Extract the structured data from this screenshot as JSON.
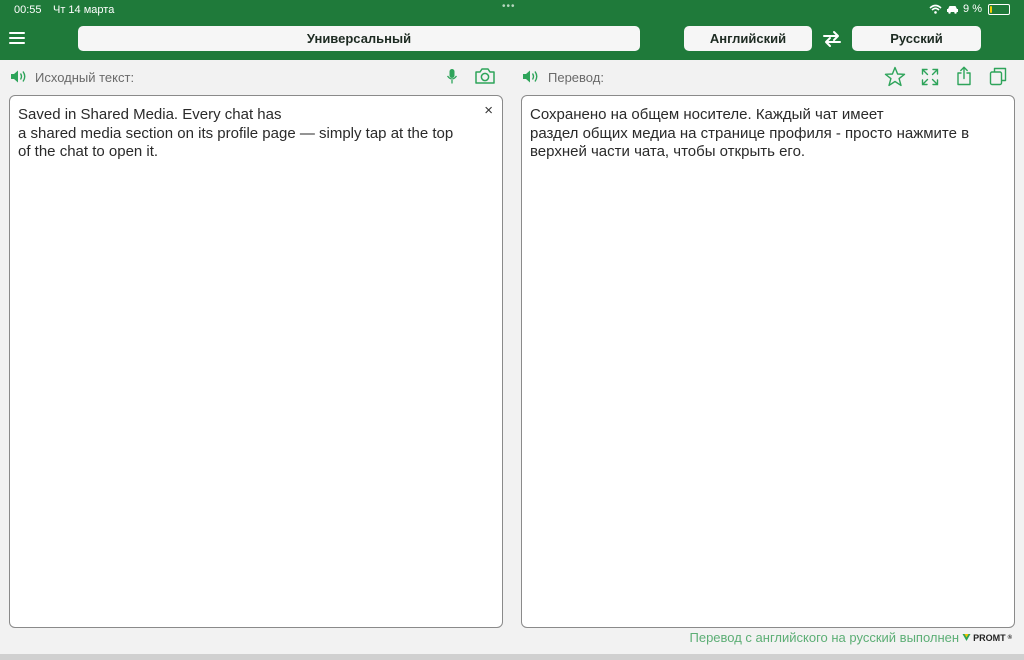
{
  "status_bar": {
    "time": "00:55",
    "date": "Чт 14 марта",
    "battery": "9 %",
    "battery_level_percent": 9
  },
  "toolbar": {
    "mode": "Универсальный",
    "source_language": "Английский",
    "target_language": "Русский"
  },
  "source_panel": {
    "label": "Исходный текст:",
    "lines": [
      "Saved in Shared Media. Every chat has",
      "a shared media section on its profile page — simply tap at the top",
      "of the chat to open it."
    ],
    "clear": "×"
  },
  "target_panel": {
    "label": "Перевод:",
    "lines": [
      "Сохранено на общем носителе. Каждый чат имеет",
      "раздел общих медиа на странице профиля - просто нажмите в",
      "верхней части чата, чтобы открыть его."
    ]
  },
  "footer": {
    "note": "Перевод с английского на русский выполнен",
    "brand": "PROMT",
    "brand_mark": "®"
  },
  "colors": {
    "brand_green": "#1f7a3a",
    "icon_green": "#2ea45a",
    "footer_text": "#5cae75",
    "battery_low": "#f5d000"
  },
  "icons": [
    "menu-icon",
    "swap-icon",
    "speaker-icon",
    "microphone-icon",
    "camera-icon",
    "star-icon",
    "expand-icon",
    "share-icon",
    "copy-icon",
    "close-icon",
    "wifi-icon",
    "car-icon",
    "battery-icon"
  ]
}
